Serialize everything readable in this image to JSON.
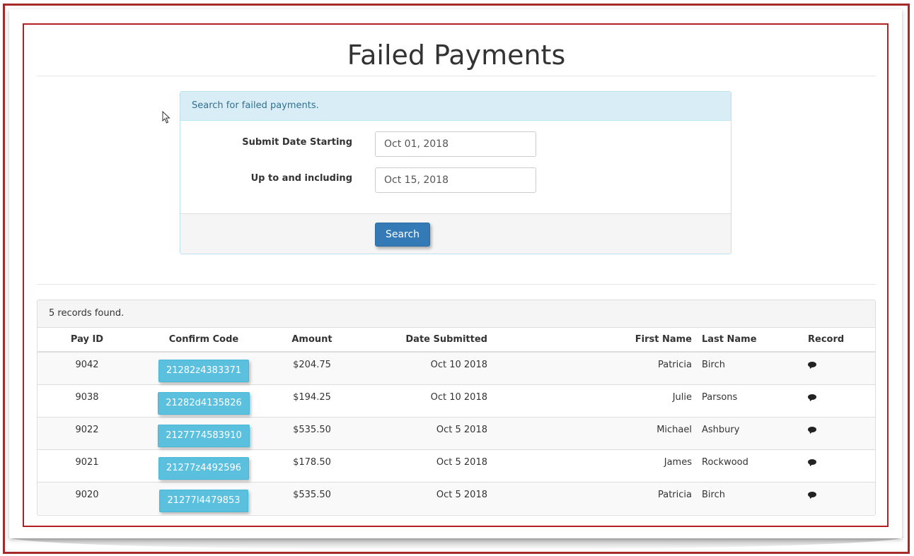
{
  "page": {
    "title": "Failed Payments"
  },
  "search_panel": {
    "heading": "Search for failed payments.",
    "start_label": "Submit Date Starting",
    "start_value": "Oct 01, 2018",
    "end_label": "Up to and including",
    "end_value": "Oct 15, 2018",
    "search_button": "Search"
  },
  "results": {
    "summary": "5 records found.",
    "columns": {
      "pay_id": "Pay ID",
      "confirm_code": "Confirm Code",
      "amount": "Amount",
      "date_submitted": "Date Submitted",
      "first_name": "First Name",
      "last_name": "Last Name",
      "record": "Record"
    },
    "rows": [
      {
        "pay_id": "9042",
        "confirm_code": "21282z4383371",
        "amount": "$204.75",
        "date": "Oct 10 2018",
        "first": "Patricia",
        "last": "Birch"
      },
      {
        "pay_id": "9038",
        "confirm_code": "21282d4135826",
        "amount": "$194.25",
        "date": "Oct 10 2018",
        "first": "Julie",
        "last": "Parsons"
      },
      {
        "pay_id": "9022",
        "confirm_code": "2127774583910",
        "amount": "$535.50",
        "date": "Oct 5 2018",
        "first": "Michael",
        "last": "Ashbury"
      },
      {
        "pay_id": "9021",
        "confirm_code": "21277z4492596",
        "amount": "$178.50",
        "date": "Oct 5 2018",
        "first": "James",
        "last": "Rockwood"
      },
      {
        "pay_id": "9020",
        "confirm_code": "21277I4479853",
        "amount": "$535.50",
        "date": "Oct 5 2018",
        "first": "Patricia",
        "last": "Birch"
      }
    ]
  },
  "icons": {
    "record_icon": "comment-icon",
    "pointer": "mouse-cursor-icon"
  },
  "colors": {
    "frame": "#b22222",
    "primary_button": "#337ab7",
    "code_button": "#5bc0de",
    "panel_heading_bg": "#d9edf7"
  }
}
